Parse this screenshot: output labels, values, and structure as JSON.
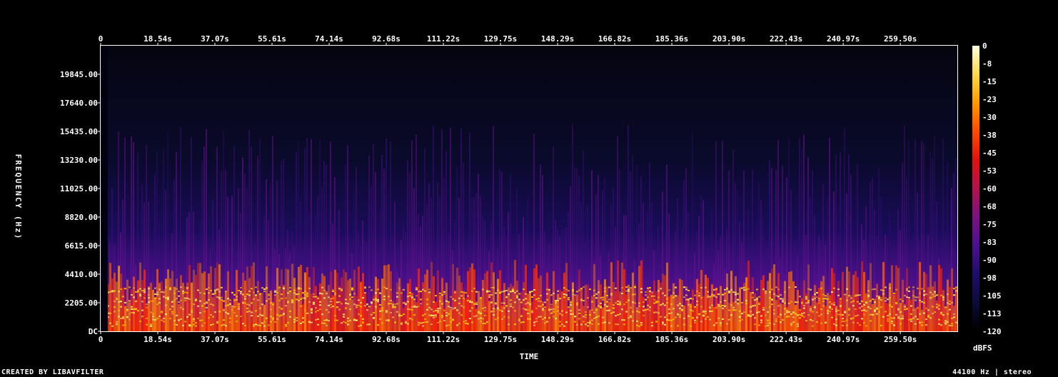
{
  "chart_data": {
    "type": "heatmap",
    "title": "",
    "xlabel": "TIME",
    "ylabel": "FREQUENCY (Hz)",
    "x_ticks": [
      "0",
      "18.54s",
      "37.07s",
      "55.61s",
      "74.14s",
      "92.68s",
      "111.22s",
      "129.75s",
      "148.29s",
      "166.82s",
      "185.36s",
      "203.90s",
      "222.43s",
      "240.97s",
      "259.50s"
    ],
    "x_tick_values": [
      0,
      18.54,
      37.07,
      55.61,
      74.14,
      92.68,
      111.22,
      129.75,
      148.29,
      166.82,
      185.36,
      203.9,
      222.43,
      240.97,
      259.5
    ],
    "xlim": [
      0,
      278.0
    ],
    "y_ticks": [
      "DC",
      "2205.00",
      "4410.00",
      "6615.00",
      "8820.00",
      "11025.00",
      "13230.00",
      "15435.00",
      "17640.00",
      "19845.00"
    ],
    "y_tick_values": [
      0,
      2205,
      4410,
      6615,
      8820,
      11025,
      13230,
      15435,
      17640,
      19845
    ],
    "ylim": [
      0,
      22050
    ],
    "colorbar": {
      "label": "dBFS",
      "ticks": [
        "0",
        "-8",
        "-15",
        "-23",
        "-30",
        "-38",
        "-45",
        "-53",
        "-60",
        "-68",
        "-75",
        "-83",
        "-90",
        "-98",
        "-105",
        "-113",
        "-120"
      ],
      "range": [
        -120,
        0
      ]
    },
    "colormap": [
      "#000000",
      "#0b0b3a",
      "#1f0d6b",
      "#4a108f",
      "#7a1280",
      "#b3124f",
      "#e0120f",
      "#ff4a00",
      "#ff9a00",
      "#ffd84a",
      "#ffffe0"
    ]
  },
  "footer": {
    "left": "CREATED BY LIBAVFILTER",
    "right": "44100 Hz | stereo"
  }
}
